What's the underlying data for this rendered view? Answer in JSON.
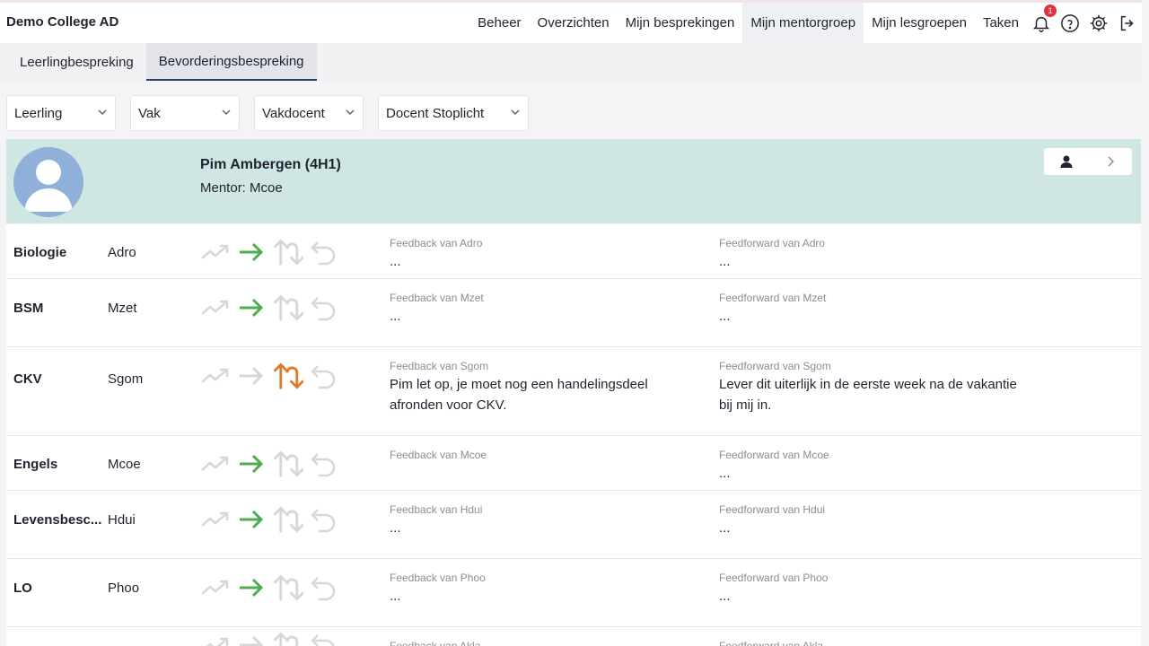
{
  "app": {
    "title": "Demo College AD"
  },
  "nav": {
    "items": [
      "Beheer",
      "Overzichten",
      "Mijn besprekingen",
      "Mijn mentorgroep",
      "Mijn lesgroepen",
      "Taken"
    ],
    "active": "Mijn mentorgroep",
    "notification_count": "1"
  },
  "tabs": [
    "Leerlingbespreking",
    "Bevorderingsbespreking"
  ],
  "filters": [
    "Leerling",
    "Vak",
    "Vakdocent",
    "Docent Stoplicht"
  ],
  "student": {
    "name": "Pim Ambergen (4H1)",
    "mentor": "Mentor: Mcoe"
  },
  "rows": [
    {
      "subject": "Biologie",
      "teacher": "Adro",
      "status": "green",
      "feedback_label": "Feedback van Adro",
      "feedback": "...",
      "feedforward_label": "Feedforward van Adro",
      "feedforward": "..."
    },
    {
      "subject": "BSM",
      "teacher": "Mzet",
      "status": "green",
      "feedback_label": "Feedback van Mzet",
      "feedback": "...",
      "feedforward_label": "Feedforward van Mzet",
      "feedforward": "..."
    },
    {
      "subject": "CKV",
      "teacher": "Sgom",
      "status": "orange",
      "feedback_label": "Feedback van Sgom",
      "feedback": "Pim let op, je moet nog een handelingsdeel afronden voor CKV.",
      "feedforward_label": "Feedforward van Sgom",
      "feedforward": "Lever dit uiterlijk in de eerste week na de vakantie bij mij in."
    },
    {
      "subject": "Engels",
      "teacher": "Mcoe",
      "status": "green",
      "feedback_label": "Feedback van Mcoe",
      "feedback": "",
      "feedforward_label": "Feedforward van Mcoe",
      "feedforward": "..."
    },
    {
      "subject": "Levensbesc...",
      "teacher": "Hdui",
      "status": "green",
      "feedback_label": "Feedback van Hdui",
      "feedback": "...",
      "feedforward_label": "Feedforward van Hdui",
      "feedforward": "..."
    },
    {
      "subject": "LO",
      "teacher": "Phoo",
      "status": "green",
      "feedback_label": "Feedback van Phoo",
      "feedback": "...",
      "feedforward_label": "Feedforward van Phoo",
      "feedforward": "..."
    },
    {
      "subject": "",
      "teacher": "",
      "status": "none",
      "feedback_label": "Feedback van Akla",
      "feedback": "",
      "feedforward_label": "Feedforward van Akla",
      "feedforward": ""
    }
  ],
  "colors": {
    "green": "#4cae4f",
    "orange": "#e07a2a",
    "inactive": "#d6d7dc",
    "accent": "#2b3a67"
  }
}
